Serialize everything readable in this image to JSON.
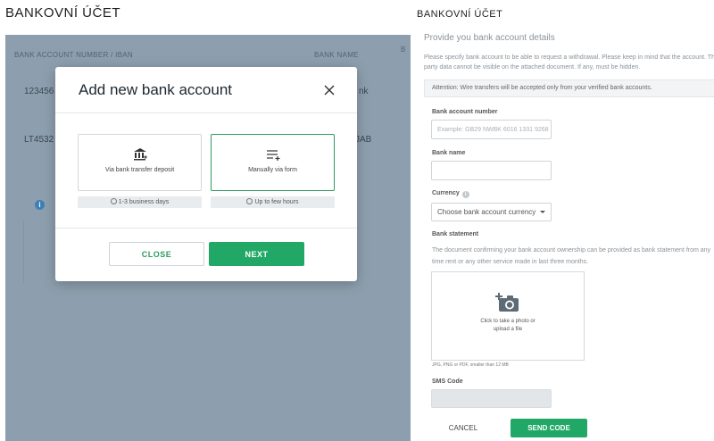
{
  "left_panel": {
    "title": "BANKOVNÍ ÚČET",
    "background_table": {
      "header_account": "BANK ACCOUNT NUMBER / IBAN",
      "header_bank": "BANK NAME",
      "header_extra": "B",
      "row1_account": "123456",
      "row1_bank": "nk",
      "row2_account": "LT4532",
      "row2_bank": "JAB",
      "info_symbol": "i"
    },
    "modal": {
      "title": "Add new bank account",
      "option_deposit": {
        "label": "Via bank transfer deposit",
        "time": "1-3 business days",
        "icon": "bank-icon"
      },
      "option_form": {
        "label": "Manually via form",
        "time": "Up to few hours",
        "icon": "list-add-icon",
        "selected": true
      },
      "close_label": "CLOSE",
      "next_label": "NEXT"
    }
  },
  "right_panel": {
    "title": "BANKOVNÍ ÚČET",
    "subtitle": "Provide you bank account details",
    "description": "Please specify bank account to be able to request a withdrawal. Please keep in mind that the account. Third party data cannot be visible on the attached document. If any, must be hidden.",
    "attention": "Attention: Wire transfers will be accepted only from your verified bank accounts.",
    "fields": {
      "account_number_label": "Bank account number",
      "account_number_placeholder": "Example: GB29 NWBK 6016 1331 9268",
      "bank_name_label": "Bank name",
      "bank_name_value": "",
      "currency_label": "Currency",
      "currency_help": "i",
      "currency_selected": "Choose bank account currency",
      "statement_label": "Bank statement",
      "statement_description": "The document confirming your bank account ownership can be provided as bank statement from any time rent or any other service made in last three months.",
      "upload_text_line1": "Click to take a photo or",
      "upload_text_line2": "upload a file",
      "upload_hint": "JPG, PNG or PDF, smaller than 12 MB",
      "sms_label": "SMS Code",
      "sms_value": ""
    },
    "cancel_label": "CANCEL",
    "send_code_label": "SEND CODE"
  },
  "colors": {
    "accent_green": "#22a866",
    "overlay_gray": "#8d9fae",
    "info_blue": "#3f7fb8"
  }
}
